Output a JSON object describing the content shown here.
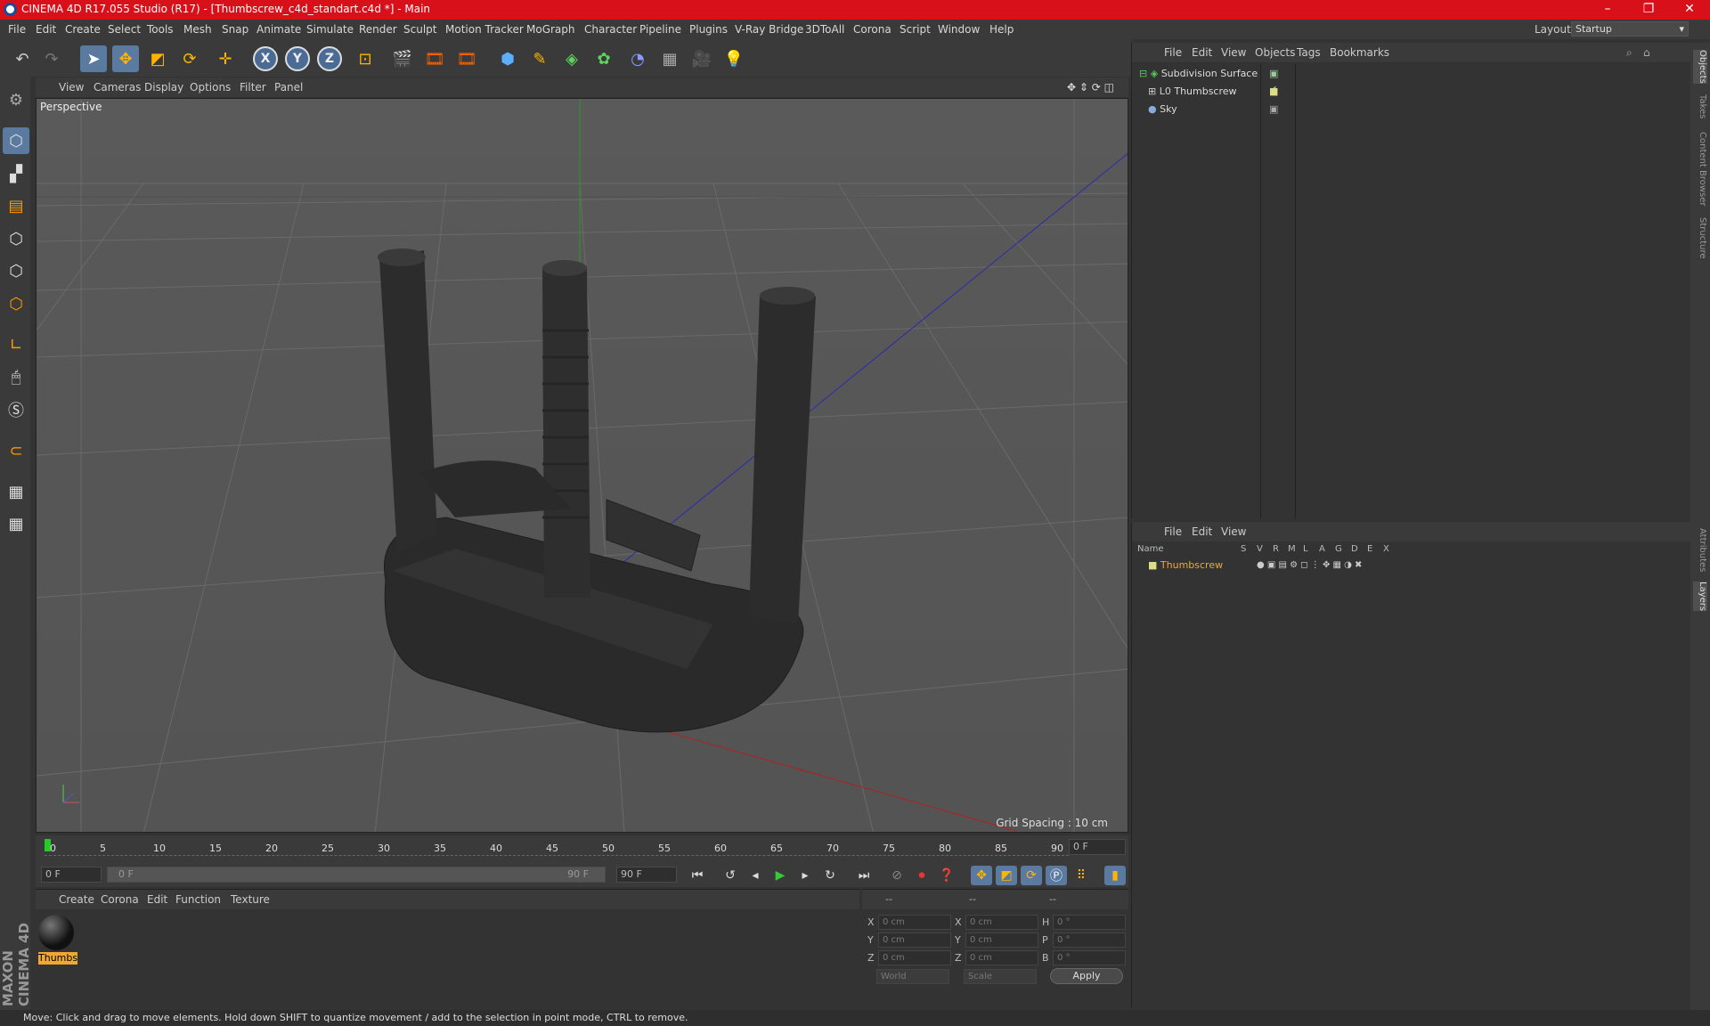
{
  "window": {
    "title": "CINEMA 4D R17.055 Studio (R17) - [Thumbscrew_c4d_standart.c4d *] - Main",
    "minimize": "–",
    "restore": "❐",
    "close": "✕"
  },
  "menubar": {
    "items": [
      "File",
      "Edit",
      "Create",
      "Select",
      "Tools",
      "Mesh",
      "Snap",
      "Animate",
      "Simulate",
      "Render",
      "Sculpt",
      "Motion Tracker",
      "MoGraph",
      "Character",
      "Pipeline",
      "Plugins",
      "V-Ray Bridge",
      "3DToAll",
      "Corona",
      "Script",
      "Window",
      "Help"
    ],
    "layout_label": "Layout:",
    "layout_value": "Startup"
  },
  "viewport": {
    "menu": [
      "View",
      "Cameras",
      "Display",
      "Options",
      "Filter",
      "Panel"
    ],
    "camera_label": "Perspective",
    "grid_spacing": "Grid Spacing : 10 cm"
  },
  "timeline": {
    "ticks": [
      "0",
      "5",
      "10",
      "15",
      "20",
      "25",
      "30",
      "35",
      "40",
      "45",
      "50",
      "55",
      "60",
      "65",
      "70",
      "75",
      "80",
      "85",
      "90"
    ],
    "current_frame": "0 F",
    "start_field": "0 F",
    "range_start": "0 F",
    "range_end": "90 F",
    "end_field": "90 F"
  },
  "material_manager": {
    "menu": [
      "Create",
      "Corona",
      "Edit",
      "Function",
      "Texture"
    ],
    "materials": [
      {
        "name": "Thumbs"
      }
    ]
  },
  "coordinates": {
    "header": [
      "--",
      "--",
      "--"
    ],
    "rows": [
      {
        "l1": "X",
        "v1": "0 cm",
        "l2": "X",
        "v2": "0 cm",
        "l3": "H",
        "v3": "0 °"
      },
      {
        "l1": "Y",
        "v1": "0 cm",
        "l2": "Y",
        "v2": "0 cm",
        "l3": "P",
        "v3": "0 °"
      },
      {
        "l1": "Z",
        "v1": "0 cm",
        "l2": "Z",
        "v2": "0 cm",
        "l3": "B",
        "v3": "0 °"
      }
    ],
    "world": "World",
    "scale": "Scale",
    "apply": "Apply"
  },
  "object_manager": {
    "menu": [
      "File",
      "Edit",
      "View",
      "Objects",
      "Tags",
      "Bookmarks"
    ],
    "objects": [
      {
        "name": "Subdivision Surface"
      },
      {
        "name": "Thumbscrew"
      },
      {
        "name": "Sky"
      }
    ]
  },
  "layer_manager": {
    "menu": [
      "File",
      "Edit",
      "View"
    ],
    "columns": [
      "Name",
      "S",
      "V",
      "R",
      "M",
      "L",
      "A",
      "G",
      "D",
      "E",
      "X"
    ],
    "layers": [
      {
        "name": "Thumbscrew"
      }
    ]
  },
  "right_tabs": [
    "Objects",
    "Takes",
    "Content Browser",
    "Structure",
    "Attributes",
    "Layers"
  ],
  "status": "Move: Click and drag to move elements. Hold down SHIFT to quantize movement / add to the selection in point mode, CTRL to remove.",
  "brand": "MAXON CINEMA 4D",
  "colors": {
    "titlebar": "#d8101a",
    "accent": "#5a7aa0",
    "layer_name": "#f0a830"
  }
}
